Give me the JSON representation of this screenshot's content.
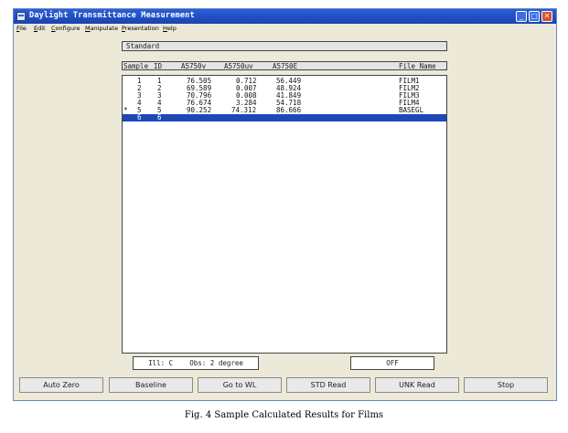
{
  "window": {
    "title": "Daylight Transmittance Measurement",
    "controls": {
      "minimize": "_",
      "maximize": "□",
      "close": "✕"
    }
  },
  "menu": [
    "File",
    "Edit",
    "Configure",
    "Manipulate",
    "Presentation",
    "Help"
  ],
  "standard_label": "Standard",
  "table": {
    "headers": {
      "sample": "Sample",
      "id": "ID",
      "c1": "A5750v",
      "c2": "A5750uv",
      "c3": "A5750E",
      "file": "File Name"
    },
    "rows": [
      {
        "marker": "",
        "sample": "1",
        "id": "1",
        "v": "76.505",
        "uv": "0.712",
        "e": "56.449",
        "file": "FILM1"
      },
      {
        "marker": "",
        "sample": "2",
        "id": "2",
        "v": "69.589",
        "uv": "0.007",
        "e": "48.924",
        "file": "FILM2"
      },
      {
        "marker": "",
        "sample": "3",
        "id": "3",
        "v": "70.796",
        "uv": "0.008",
        "e": "41.849",
        "file": "FILM3"
      },
      {
        "marker": "",
        "sample": "4",
        "id": "4",
        "v": "76.674",
        "uv": "3.284",
        "e": "54.718",
        "file": "FILM4"
      },
      {
        "marker": "*",
        "sample": "5",
        "id": "5",
        "v": "90.252",
        "uv": "74.312",
        "e": "86.666",
        "file": "BASEGL"
      },
      {
        "marker": "",
        "sample": "6",
        "id": "6",
        "v": "",
        "uv": "",
        "e": "",
        "file": ""
      }
    ]
  },
  "status": {
    "illuminant": "Ill: C",
    "observer": "Obs: 2 degree",
    "state": "OFF"
  },
  "buttons": [
    "Auto Zero",
    "Baseline",
    "Go to WL",
    "STD Read",
    "UNK Read",
    "Stop"
  ],
  "caption": "Fig. 4  Sample Calculated Results for Films",
  "colors": {
    "titlebar": "#1f4fc2",
    "selection": "#1c49b7",
    "window_bg": "#ece9d8"
  }
}
